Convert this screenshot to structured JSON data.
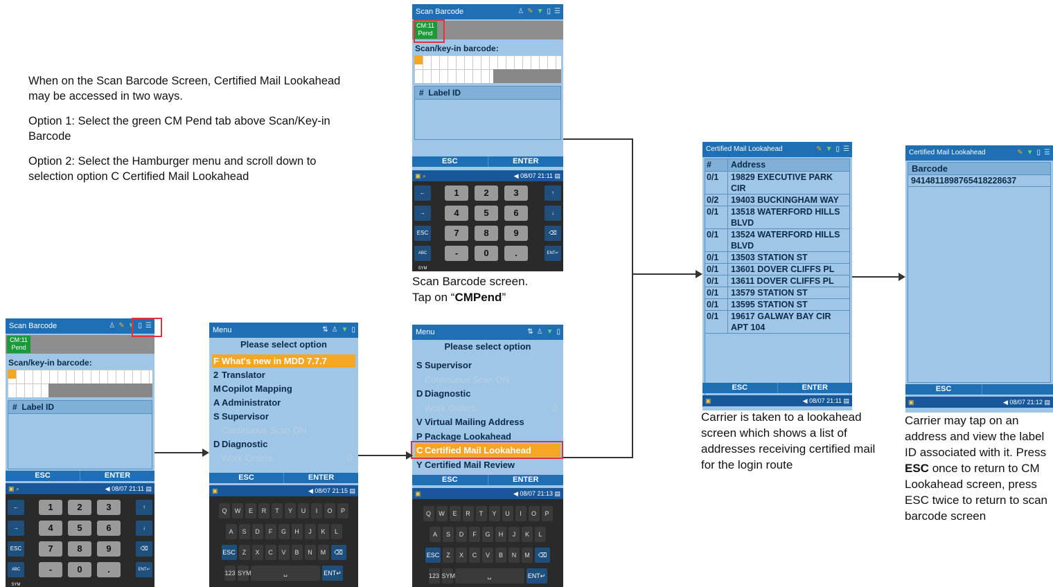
{
  "intro": {
    "line1": "When on the Scan Barcode Screen, Certified Mail Lookahead may be accessed in two ways.",
    "line2": "Option 1:  Select the green CM Pend tab above Scan/Key-in Barcode",
    "line3": "Option 2:  Select the Hamburger menu and scroll down to selection option C Certified Mail Lookahead"
  },
  "captions": {
    "scan_top_line1": "Scan Barcode screen.",
    "scan_top_line2_pre": "Tap on “",
    "scan_top_line2_bold": "CMPend",
    "scan_top_line2_post": "”",
    "lookahead": "Carrier is taken to a lookahead screen which shows a list of addresses receiving certified mail for the login route",
    "detail_1": "Carrier may tap on an address and view the label ID associated with it. Press ",
    "detail_esc": "ESC",
    "detail_2": " once to return to CM Lookahead screen, press ESC twice to return to scan barcode screen"
  },
  "scan_screen": {
    "title": "Scan Barcode",
    "cm_tab_line1": "CM:11",
    "cm_tab_line2": "Pend",
    "scan_label": "Scan/key-in barcode:",
    "col_hash": "#",
    "col_label": "Label ID",
    "esc": "ESC",
    "enter": "ENTER",
    "datetime": "08/07 21:11",
    "side_left": [
      "←",
      "→",
      "ESC",
      "ABC SYM"
    ],
    "side_right": [
      "↑",
      "↓",
      "⌫",
      "ENT↵"
    ],
    "keys": [
      "1",
      "2",
      "3",
      "4",
      "5",
      "6",
      "7",
      "8",
      "9",
      "-",
      "0",
      "."
    ]
  },
  "menu1": {
    "title": "Menu",
    "heading": "Please select option",
    "items": [
      {
        "key": "F",
        "label": "What's new in MDD 7.7.7",
        "count": ""
      },
      {
        "key": "2",
        "label": "Translator",
        "count": ""
      },
      {
        "key": "M",
        "label": "Copilot Mapping",
        "count": ""
      },
      {
        "key": "A",
        "label": "Administrator",
        "count": ""
      },
      {
        "key": "S",
        "label": "Supervisor",
        "count": ""
      },
      {
        "key": "",
        "label": "Continuous Scan ON",
        "count": ""
      },
      {
        "key": "D",
        "label": "Diagnostic",
        "count": ""
      },
      {
        "key": "",
        "label": "Work Orders",
        "count": "0"
      }
    ],
    "esc": "ESC",
    "enter": "ENTER",
    "datetime": "08/07 21:15"
  },
  "menu2": {
    "title": "Menu",
    "heading": "Please select option",
    "items": [
      {
        "key": "S",
        "label": "Supervisor",
        "count": ""
      },
      {
        "key": "",
        "label": "Continuous Scan ON",
        "count": ""
      },
      {
        "key": "D",
        "label": "Diagnostic",
        "count": ""
      },
      {
        "key": "",
        "label": "Work Orders",
        "count": "0"
      },
      {
        "key": "V",
        "label": "Virtual Mailing Address",
        "count": ""
      },
      {
        "key": "P",
        "label": "Package Lookahead",
        "count": ""
      },
      {
        "key": "C",
        "label": "Certified Mail Lookahead",
        "count": ""
      },
      {
        "key": "Y",
        "label": "Certified Mail Review",
        "count": ""
      }
    ],
    "esc": "ESC",
    "enter": "ENTER",
    "datetime": "08/07 21:13"
  },
  "keyboard": {
    "row1": [
      "Q",
      "W",
      "E",
      "R",
      "T",
      "Y",
      "U",
      "I",
      "O",
      "P"
    ],
    "row2": [
      "A",
      "S",
      "D",
      "F",
      "G",
      "H",
      "J",
      "K",
      "L"
    ],
    "row3": [
      "ESC",
      "Z",
      "X",
      "C",
      "V",
      "B",
      "N",
      "M",
      "⌫"
    ],
    "row4": [
      "123",
      "SYM",
      "␣",
      "ENT↵"
    ]
  },
  "lookahead": {
    "title": "Certified Mail Lookahead",
    "col_hash": "#",
    "col_address": "Address",
    "rows": [
      {
        "n": "0/1",
        "addr": "19829 EXECUTIVE PARK CIR"
      },
      {
        "n": "0/2",
        "addr": "19403 BUCKINGHAM WAY"
      },
      {
        "n": "0/1",
        "addr": "13518 WATERFORD HILLS BLVD"
      },
      {
        "n": "0/1",
        "addr": "13524 WATERFORD HILLS BLVD"
      },
      {
        "n": "0/1",
        "addr": "13503 STATION ST"
      },
      {
        "n": "0/1",
        "addr": "13601 DOVER CLIFFS PL"
      },
      {
        "n": "0/1",
        "addr": "13611 DOVER CLIFFS PL"
      },
      {
        "n": "0/1",
        "addr": "13579 STATION ST"
      },
      {
        "n": "0/1",
        "addr": "13595 STATION ST"
      },
      {
        "n": "0/1",
        "addr": "19617 GALWAY BAY CIR APT 104"
      }
    ],
    "esc": "ESC",
    "enter": "ENTER",
    "datetime": "08/07 21:11"
  },
  "detail": {
    "title": "Certified Mail Lookahead",
    "col_barcode": "Barcode",
    "barcode": "9414811898765418228637",
    "esc": "ESC",
    "datetime": "08/07 21:12"
  },
  "colors": {
    "titlebar": "#1f6fb4",
    "screen": "#9fc6e6",
    "cm_tab": "#1c9a3a",
    "highlight": "#f5a623",
    "callout": "#e0323c"
  }
}
